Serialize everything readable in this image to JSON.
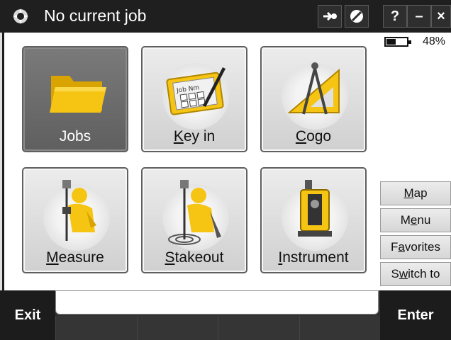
{
  "titlebar": {
    "title": "No current job",
    "buttons": [
      "→",
      "⊘",
      "?",
      "–",
      "×"
    ]
  },
  "tiles": [
    {
      "label_pre": "",
      "label_u": "",
      "label_post": "Jobs",
      "icon": "folder-icon",
      "selected": true
    },
    {
      "label_pre": "",
      "label_u": "K",
      "label_post": "ey in",
      "icon": "keypad-icon",
      "selected": false
    },
    {
      "label_pre": "",
      "label_u": "C",
      "label_post": "ogo",
      "icon": "compass-triangle-icon",
      "selected": false
    },
    {
      "label_pre": "",
      "label_u": "M",
      "label_post": "easure",
      "icon": "surveyor-icon",
      "selected": false
    },
    {
      "label_pre": "",
      "label_u": "S",
      "label_post": "takeout",
      "icon": "stakeout-surveyor-icon",
      "selected": false
    },
    {
      "label_pre": "",
      "label_u": "I",
      "label_post": "nstrument",
      "icon": "total-station-icon",
      "selected": false
    }
  ],
  "status": {
    "battery_text": "48%",
    "battery_level": 0.48
  },
  "side_buttons": {
    "map": {
      "pre": "",
      "u": "M",
      "post": "ap"
    },
    "menu": {
      "pre": "M",
      "u": "e",
      "post": "nu"
    },
    "favorites": {
      "pre": "F",
      "u": "a",
      "post": "vorites"
    },
    "switch_to": {
      "pre": "S",
      "u": "w",
      "post": "itch to"
    }
  },
  "bottom": {
    "exit_label": "Exit",
    "enter_label": "Enter"
  },
  "colors": {
    "titlebar_bg": "#1f1f1f",
    "selected_tile": "#6b6b6b",
    "icon_yellow": "#f6c514"
  }
}
